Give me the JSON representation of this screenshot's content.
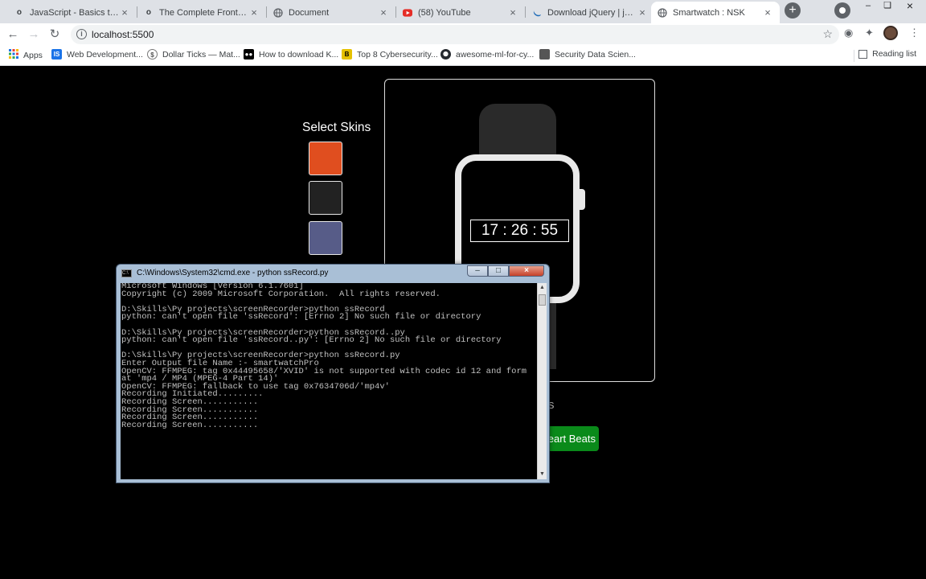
{
  "browser": {
    "tabs": [
      {
        "title": "JavaScript - Basics to Adv",
        "icon": "udemy-icon"
      },
      {
        "title": "The Complete Front-End",
        "icon": "udemy-icon"
      },
      {
        "title": "Document",
        "icon": "globe-icon"
      },
      {
        "title": "(58) YouTube",
        "icon": "youtube-icon"
      },
      {
        "title": "Download jQuery | jQuery",
        "icon": "jquery-icon"
      },
      {
        "title": "Smartwatch : NSK",
        "icon": "globe-icon"
      }
    ],
    "active_tab_index": 5,
    "url": "localhost:5500",
    "bookmarks": [
      {
        "label": "Apps",
        "icon": "apps-grid-icon"
      },
      {
        "label": "Web Development...",
        "icon": "is-icon"
      },
      {
        "label": "Dollar Ticks — Mat...",
        "icon": "dollar-ticks-icon"
      },
      {
        "label": "How to download K...",
        "icon": "medium-icon"
      },
      {
        "label": "Top 8 Cybersecurity...",
        "icon": "cyber-icon"
      },
      {
        "label": "awesome-ml-for-cy...",
        "icon": "github-icon"
      },
      {
        "label": "Security Data Scien...",
        "icon": "security-icon"
      }
    ],
    "reading_list": "Reading list"
  },
  "page": {
    "skins_title": "Select Skins",
    "skin_colors": [
      "#e04e1f",
      "#222222",
      "#575c88"
    ],
    "time": "17 : 26 : 55",
    "partial_label": "s",
    "heart_button": "Heart Beats",
    "colors": {
      "strap": "#2a2a2a",
      "watch_frame": "#e9e9e9",
      "heart_button": "#0a8a1a"
    }
  },
  "cmd": {
    "title": "C:\\Windows\\System32\\cmd.exe - python  ssRecord.py",
    "lines": [
      "Microsoft Windows [Version 6.1.7601]",
      "Copyright (c) 2009 Microsoft Corporation.  All rights reserved.",
      "",
      "D:\\Skills\\Py projects\\screenRecorder>python ssRecord",
      "python: can't open file 'ssRecord': [Errno 2] No such file or directory",
      "",
      "D:\\Skills\\Py projects\\screenRecorder>python ssRecord..py",
      "python: can't open file 'ssRecord..py': [Errno 2] No such file or directory",
      "",
      "D:\\Skills\\Py projects\\screenRecorder>python ssRecord.py",
      "Enter Output file Name :- smartwatchPro",
      "OpenCV: FFMPEG: tag 0x44495658/'XVID' is not supported with codec id 12 and form",
      "at 'mp4 / MP4 (MPEG-4 Part 14)'",
      "OpenCV: FFMPEG: fallback to use tag 0x7634706d/'mp4v'",
      "Recording Initiated.........",
      "Recording Screen...........",
      "Recording Screen...........",
      "Recording Screen...........",
      "Recording Screen..........."
    ]
  }
}
